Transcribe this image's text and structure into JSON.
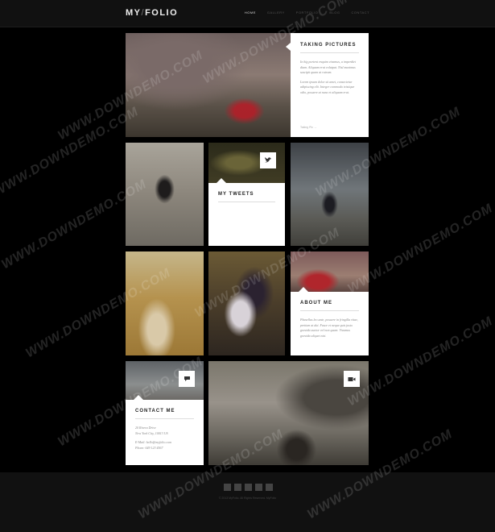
{
  "header": {
    "logo_left": "MY",
    "logo_slash": "/",
    "logo_right": "FOLIO",
    "nav": [
      "Home",
      "Gallery",
      "Portfolio",
      "Blog",
      "Contact"
    ]
  },
  "tiles": {
    "taking_pictures": {
      "title": "TAKING PICTURES",
      "para1": "In hig portent enquim vivamus, a imperdiet diam. Aliquam erat volutpat. Nisl maximus suscipit quam at rutrum.",
      "para2": "Lorem ipsum dolor sit amet, consectetur adipiscing elit. Integer commodo tristique odio, posuere at nunc et aliquam erat.",
      "link": "Taking Pic →"
    },
    "tweets": {
      "title": "MY TWEETS"
    },
    "about": {
      "title": "ABOUT ME",
      "text": "Phasellus leo ante, posuere in fringilla vitae, pretium at dui. Fusce et neque quis justo gravida auctor vel non quam. Vivamus gravida aliquet nisi."
    },
    "contact": {
      "title": "CONTACT ME",
      "address1": "20 Rivera Drive",
      "address2": "New York City, 10013 US",
      "email": "E-Mail: hello@myfolio.com",
      "phone": "Phone: 649 123 4567"
    }
  },
  "footer": {
    "socials": [
      "twitter",
      "facebook",
      "flickr",
      "dribbble",
      "vimeo"
    ],
    "copyright": "© 2013 MyFolio. All Rights Reserved. MyFolio"
  },
  "watermark": "WWW.DOWNDEMO.COM",
  "colors": {
    "background": "#000000",
    "panel": "#ffffff",
    "header": "#111111"
  }
}
